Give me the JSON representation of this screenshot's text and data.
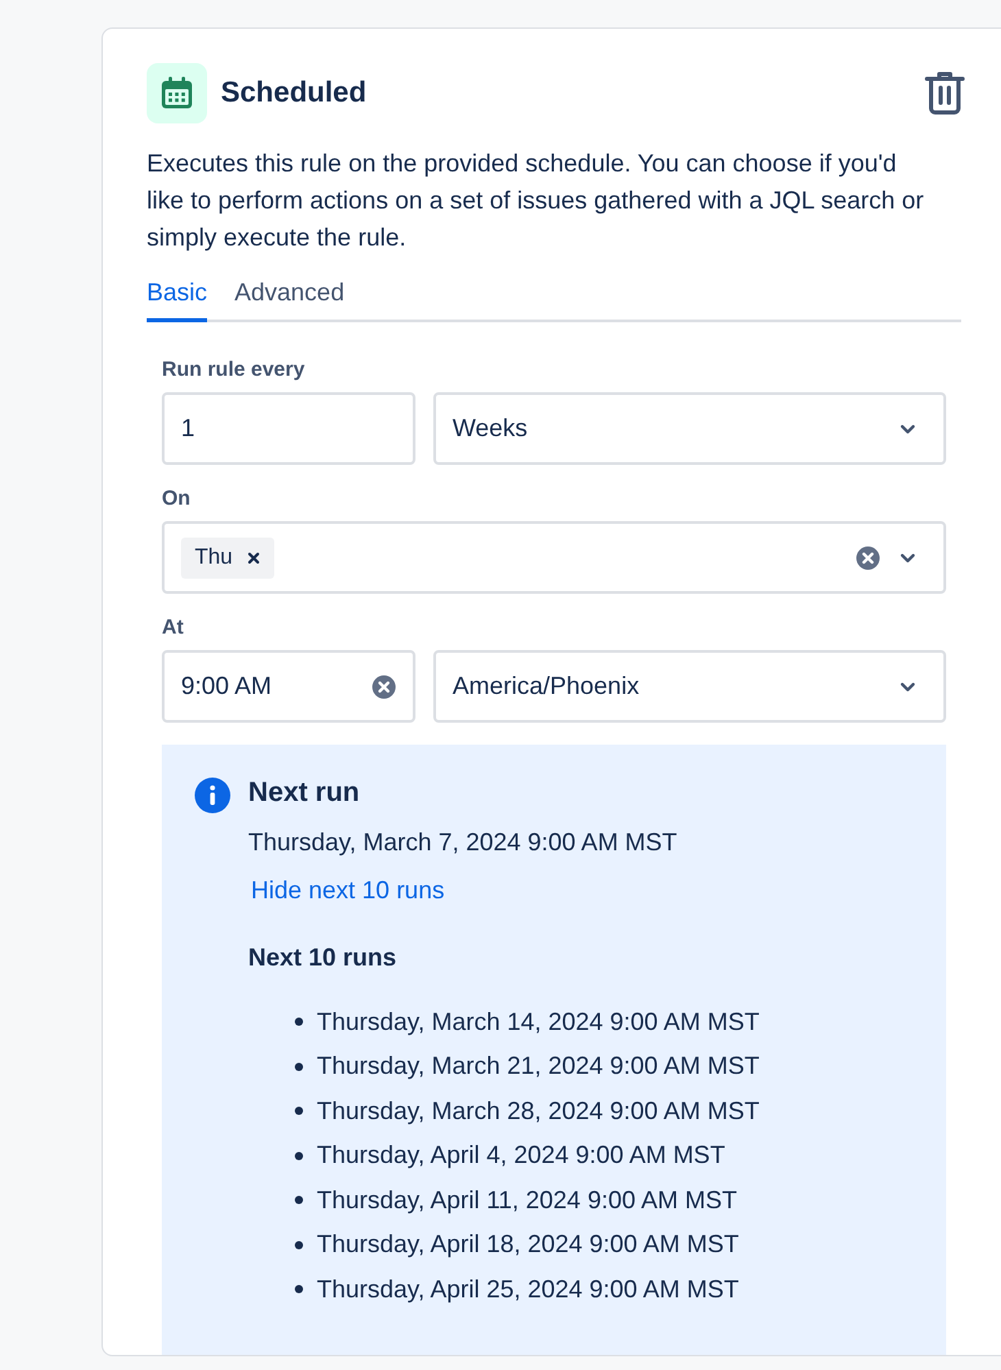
{
  "header": {
    "title": "Scheduled"
  },
  "description": "Executes this rule on the provided schedule. You can choose if you'd like to perform actions on a set of issues gathered with a JQL search or simply execute the rule.",
  "tabs": [
    {
      "label": "Basic",
      "selected": true
    },
    {
      "label": "Advanced",
      "selected": false
    }
  ],
  "fields": [
    {
      "label": "Run rule every",
      "controls": [
        {
          "kind": "text",
          "value": "1"
        },
        {
          "kind": "select",
          "value": "Weeks"
        }
      ]
    },
    {
      "label": "On",
      "controls": [
        {
          "kind": "multiselect",
          "tags": [
            "Thu"
          ],
          "clearable": true
        }
      ]
    },
    {
      "label": "At",
      "controls": [
        {
          "kind": "time",
          "value": "9:00 AM",
          "clearable": true
        },
        {
          "kind": "select",
          "value": "America/Phoenix"
        }
      ]
    }
  ],
  "info": {
    "title": "Next run",
    "next_run": "Thursday, March 7, 2024 9:00 AM MST",
    "link": "Hide next 10 runs",
    "list_title": "Next 10 runs",
    "runs": [
      "Thursday, March 14, 2024 9:00 AM MST",
      "Thursday, March 21, 2024 9:00 AM MST",
      "Thursday, March 28, 2024 9:00 AM MST",
      "Thursday, April 4, 2024 9:00 AM MST",
      "Thursday, April 11, 2024 9:00 AM MST",
      "Thursday, April 18, 2024 9:00 AM MST",
      "Thursday, April 25, 2024 9:00 AM MST"
    ]
  }
}
